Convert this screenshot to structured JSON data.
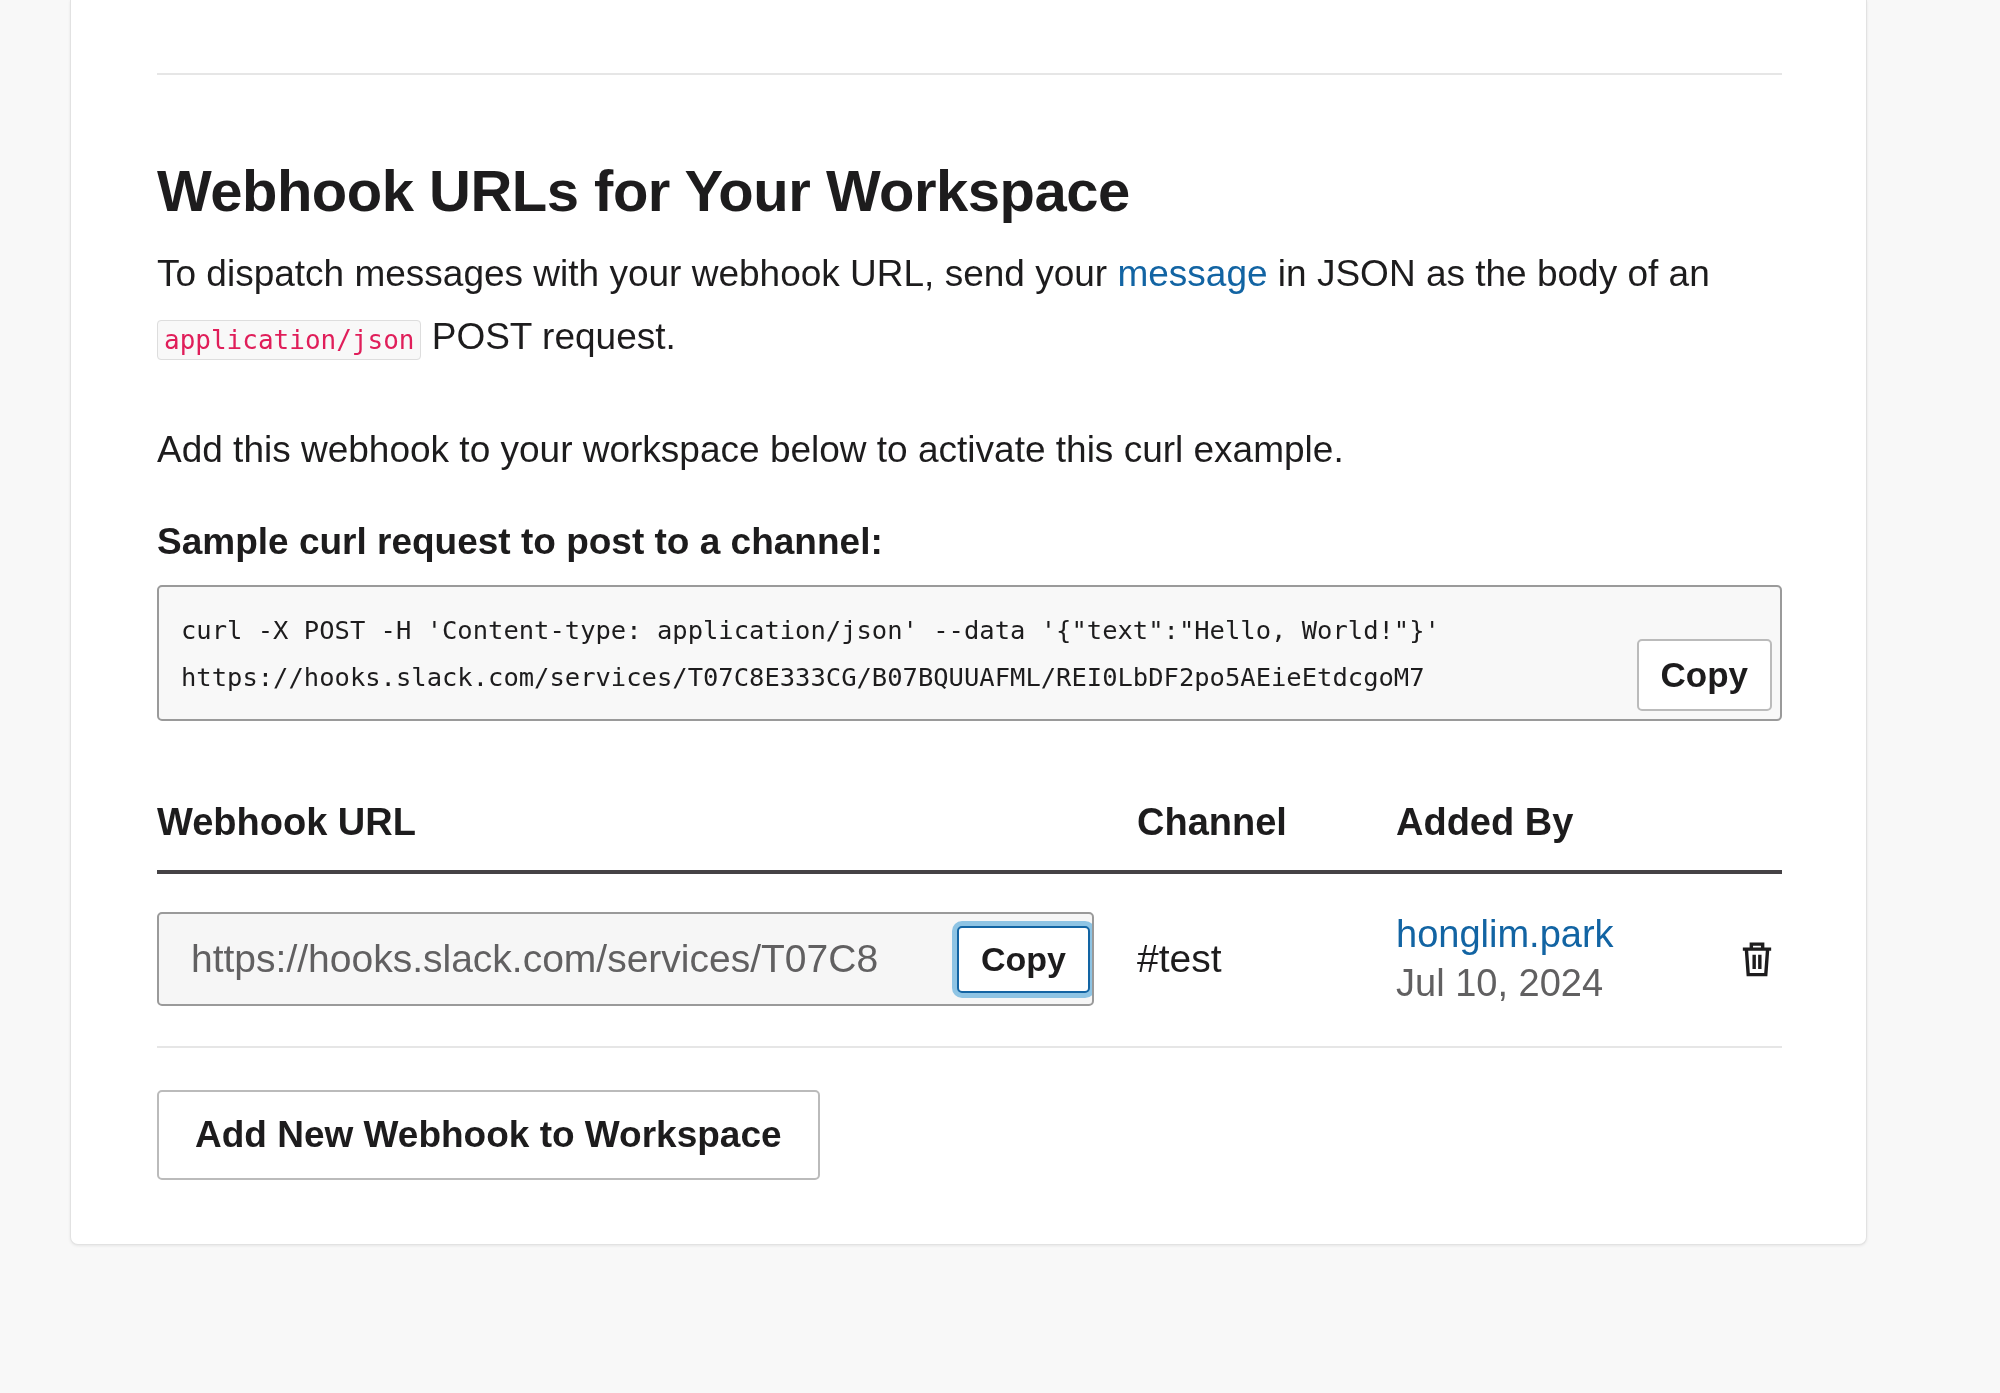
{
  "section": {
    "title": "Webhook URLs for Your Workspace",
    "intro_before_link": "To dispatch messages with your webhook URL, send your",
    "intro_link": "message",
    "intro_after_link": "in JSON as the body of an",
    "intro_code": "application/json",
    "intro_end": "POST request.",
    "note": "Add this webhook to your workspace below to activate this curl example.",
    "sample_label": "Sample curl request to post to a channel:",
    "sample_lines": [
      "curl -X POST -H 'Content-type: application/json' --data '{\"text\":\"Hello, World!\"}'",
      "https://hooks.slack.com/services/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"
    ],
    "sample_copy": "Copy"
  },
  "table": {
    "columns": [
      "Webhook URL",
      "Channel",
      "Added By"
    ],
    "rows": [
      {
        "url": "https://hooks.slack.com/services/T07C8",
        "copy": "Copy",
        "copy_focused": true,
        "channel": "#test",
        "added_by": "honglim.park",
        "date": "Jul 10, 2024"
      }
    ]
  },
  "add_button": "Add New Webhook to Workspace"
}
